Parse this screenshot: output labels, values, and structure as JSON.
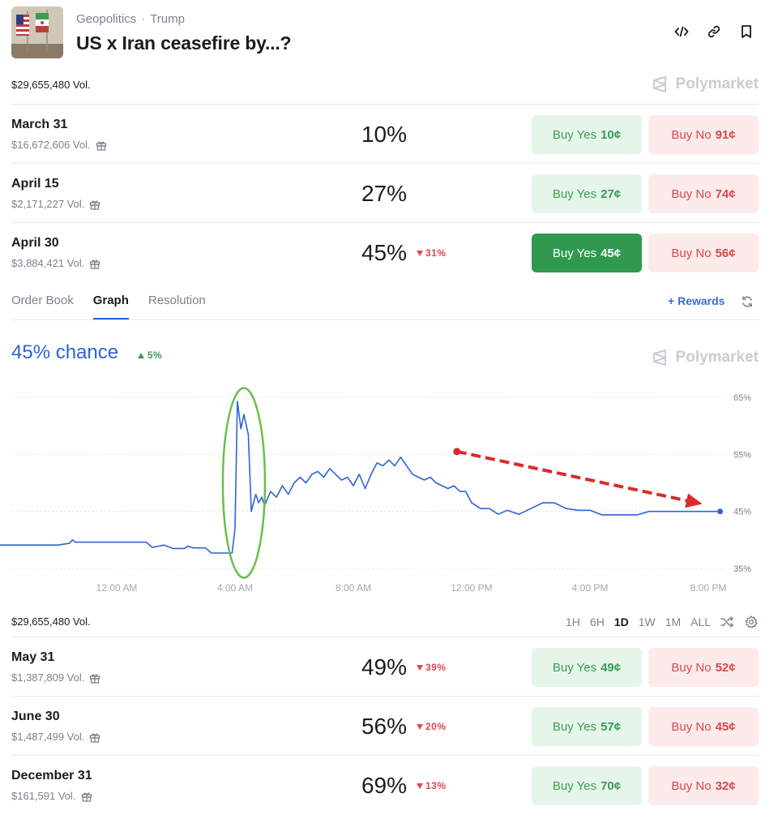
{
  "header": {
    "category": "Geopolitics",
    "tag": "Trump",
    "title": "US x Iran ceasefire by...?",
    "total_volume": "$29,655,480 Vol.",
    "brand": "Polymarket"
  },
  "top_markets": [
    {
      "date": "March 31",
      "volume": "$16,672,606 Vol.",
      "pct": "10%",
      "change": "",
      "yes_label": "Buy Yes",
      "yes_price": "10¢",
      "no_label": "Buy No",
      "no_price": "91¢"
    },
    {
      "date": "April 15",
      "volume": "$2,171,227 Vol.",
      "pct": "27%",
      "change": "",
      "yes_label": "Buy Yes",
      "yes_price": "27¢",
      "no_label": "Buy No",
      "no_price": "74¢"
    },
    {
      "date": "April 30",
      "volume": "$3,884,421 Vol.",
      "pct": "45%",
      "change": "31%",
      "yes_label": "Buy Yes",
      "yes_price": "45¢",
      "no_label": "Buy No",
      "no_price": "56¢"
    }
  ],
  "tabs": [
    "Order Book",
    "Graph",
    "Resolution"
  ],
  "active_tab": "Graph",
  "rewards_label": "Rewards",
  "graph": {
    "chance_label": "45% chance",
    "chance_change": "5%",
    "brand": "Polymarket",
    "volume": "$29,655,480 Vol.",
    "ranges": [
      "1H",
      "6H",
      "1D",
      "1W",
      "1M",
      "ALL"
    ],
    "active_range": "1D"
  },
  "chart_data": {
    "type": "line",
    "title": "",
    "xlabel": "",
    "ylabel": "",
    "x_ticks": [
      "12:00 AM",
      "4:00 AM",
      "8:00 AM",
      "12:00 PM",
      "4:00 PM",
      "8:00 PM"
    ],
    "y_ticks": [
      "65%",
      "55%",
      "45%",
      "35%"
    ],
    "ylim": [
      35,
      65
    ],
    "grid": true,
    "line_color": "#2d63d8",
    "series": [
      {
        "x": [
          -4.0,
          -2.0,
          -1.6,
          -1.5,
          -1.4,
          1.0,
          1.2,
          1.6,
          1.9,
          2.3,
          2.4,
          2.6,
          3.0,
          3.2,
          3.9,
          4.0,
          4.08,
          4.2,
          4.3,
          4.45,
          4.55,
          4.7,
          4.8,
          4.9,
          5.0,
          5.2,
          5.4,
          5.6,
          5.8,
          6.0,
          6.2,
          6.4,
          6.6,
          6.8,
          7.0,
          7.2,
          7.4,
          7.6,
          7.8,
          8.0,
          8.2,
          8.4,
          8.6,
          8.8,
          9.0,
          9.2,
          9.4,
          9.6,
          9.8,
          10.0,
          10.2,
          10.4,
          10.6,
          10.8,
          11.0,
          11.2,
          11.4,
          11.6,
          11.8,
          12.0,
          12.3,
          12.6,
          12.9,
          13.2,
          13.6,
          14.0,
          14.4,
          14.8,
          15.2,
          15.6,
          16.0,
          16.4,
          16.8,
          17.2,
          17.6,
          18.0,
          18.4,
          18.8,
          19.2,
          19.6,
          20.0,
          20.4
        ],
        "values": [
          39.1,
          39.1,
          39.4,
          40.0,
          39.6,
          39.6,
          38.7,
          39.1,
          38.5,
          38.5,
          38.9,
          38.6,
          38.6,
          37.7,
          37.7,
          42.0,
          64.3,
          59.5,
          62.0,
          58.5,
          45.0,
          48.0,
          46.5,
          47.5,
          46.0,
          48.5,
          47.5,
          49.5,
          48.0,
          50.0,
          51.0,
          50.0,
          51.5,
          52.0,
          51.0,
          52.5,
          51.5,
          50.5,
          51.0,
          49.5,
          51.5,
          49.0,
          51.5,
          53.5,
          53.0,
          54.0,
          53.0,
          54.5,
          53.0,
          51.5,
          51.0,
          50.5,
          51.0,
          50.0,
          49.5,
          49.0,
          49.5,
          48.5,
          48.5,
          46.5,
          45.5,
          45.5,
          44.5,
          45.2,
          44.5,
          45.5,
          46.5,
          46.5,
          45.5,
          45.2,
          45.2,
          44.4,
          44.4,
          44.4,
          44.4,
          45,
          45,
          45,
          45,
          45,
          45,
          45
        ]
      }
    ],
    "annotations": [
      {
        "type": "ellipse",
        "color": "#6abf4b",
        "x": 4.3,
        "y": 50
      },
      {
        "type": "arrow",
        "color": "#d92b2b",
        "from": {
          "x": 11.5,
          "y": 55.5
        },
        "to": {
          "x": 19.8,
          "y": 46.3
        }
      }
    ]
  },
  "bottom_markets": [
    {
      "date": "May 31",
      "volume": "$1,387,809 Vol.",
      "pct": "49%",
      "change": "39%",
      "yes_label": "Buy Yes",
      "yes_price": "49¢",
      "no_label": "Buy No",
      "no_price": "52¢"
    },
    {
      "date": "June 30",
      "volume": "$1,487,499 Vol.",
      "pct": "56%",
      "change": "20%",
      "yes_label": "Buy Yes",
      "yes_price": "57¢",
      "no_label": "Buy No",
      "no_price": "45¢"
    },
    {
      "date": "December 31",
      "volume": "$161,591 Vol.",
      "pct": "69%",
      "change": "13%",
      "yes_label": "Buy Yes",
      "yes_price": "70¢",
      "no_label": "Buy No",
      "no_price": "32¢"
    }
  ]
}
